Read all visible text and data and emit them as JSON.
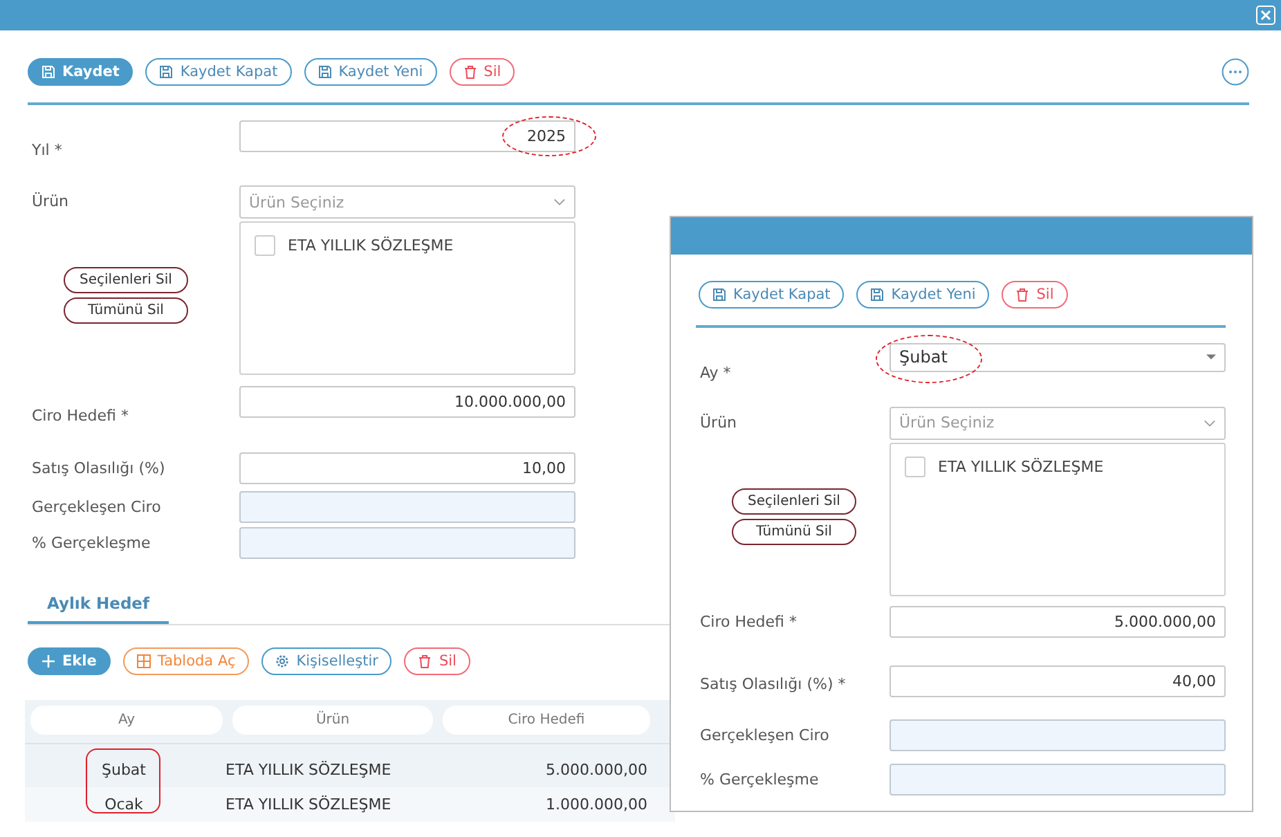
{
  "toolbar": {
    "buttons": [
      {
        "label": "Kaydet",
        "kind": "save-primary"
      },
      {
        "label": "Kaydet Kapat",
        "kind": "save"
      },
      {
        "label": "Kaydet Yeni",
        "kind": "save"
      },
      {
        "label": "Sil",
        "kind": "delete"
      }
    ]
  },
  "form": {
    "fields": [
      {
        "label": "Yıl *",
        "kind": "number",
        "value": "2025",
        "highlighted": true
      },
      {
        "label": "Ürün",
        "kind": "multiselect",
        "placeholder": "Ürün Seçiniz",
        "options": [
          {
            "label": "ETA YILLIK SÖZLEŞME",
            "checked": false
          }
        ],
        "actions": [
          "Seçilenleri Sil",
          "Tümünü Sil"
        ]
      },
      {
        "label": "Ciro Hedefi *",
        "kind": "number",
        "value": "10.000.000,00",
        "highlighted": false
      },
      {
        "label": "Satış Olasılığı (%)",
        "kind": "number",
        "value": "10,00",
        "highlighted": false
      },
      {
        "label": "Gerçekleşen Ciro",
        "kind": "readonly"
      },
      {
        "label": "% Gerçekleşme",
        "kind": "readonly"
      }
    ]
  },
  "tabs": [
    {
      "label": "Aylık Hedef",
      "selected": true
    }
  ],
  "grid_toolbar": {
    "buttons": [
      {
        "label": "Ekle",
        "kind": "add"
      },
      {
        "label": "Tabloda Aç",
        "kind": "table"
      },
      {
        "label": "Kişiselleştir",
        "kind": "settings"
      },
      {
        "label": "Sil",
        "kind": "delete"
      }
    ]
  },
  "table": {
    "columns": [
      "Ay",
      "Ürün",
      "Ciro Hedefi"
    ],
    "highlight_first_column": true,
    "rows": [
      [
        "Şubat",
        "ETA YILLIK SÖZLEŞME",
        "5.000.000,00"
      ],
      [
        "Ocak",
        "ETA YILLIK SÖZLEŞME",
        "1.000.000,00"
      ]
    ]
  },
  "dialog": {
    "toolbar": {
      "buttons": [
        {
          "label": "Kaydet Kapat",
          "kind": "save"
        },
        {
          "label": "Kaydet Yeni",
          "kind": "save"
        },
        {
          "label": "Sil",
          "kind": "delete"
        }
      ]
    },
    "form": {
      "fields": [
        {
          "label": "Ay *",
          "kind": "dropdown",
          "value": "Şubat",
          "highlighted": true
        },
        {
          "label": "Ürün",
          "kind": "multiselect",
          "placeholder": "Ürün Seçiniz",
          "options": [
            {
              "label": "ETA YILLIK SÖZLEŞME",
              "checked": false
            }
          ],
          "actions": [
            "Seçilenleri Sil",
            "Tümünü Sil"
          ]
        },
        {
          "label": "Ciro Hedefi *",
          "kind": "number",
          "value": "5.000.000,00",
          "highlighted": false
        },
        {
          "label": "Satış Olasılığı (%) *",
          "kind": "number",
          "value": "40,00",
          "highlighted": false
        },
        {
          "label": "Gerçekleşen Ciro",
          "kind": "readonly"
        },
        {
          "label": "% Gerçekleşme",
          "kind": "readonly"
        }
      ]
    }
  }
}
